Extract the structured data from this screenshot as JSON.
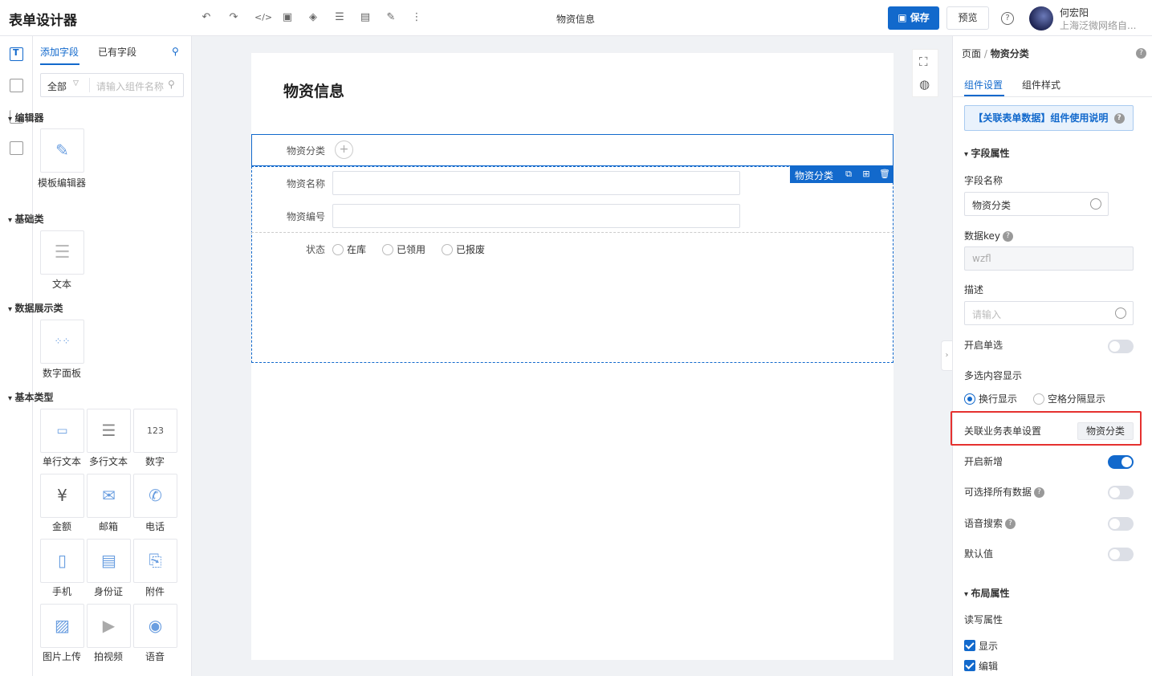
{
  "header": {
    "app_title": "表单设计器",
    "form_name": "物资信息",
    "save_label": "保存",
    "preview_label": "预览",
    "help_label": "?",
    "user_name": "何宏阳",
    "user_company": "上海泛微网络自..."
  },
  "left_panel": {
    "tabs": [
      "添加字段",
      "已有字段"
    ],
    "active_tab": "添加字段",
    "filter_value": "全部",
    "search_placeholder": "请输入组件名称",
    "categories": [
      {
        "name": "编辑器",
        "widgets": [
          "模板编辑器"
        ]
      },
      {
        "name": "基础类",
        "widgets": [
          "文本"
        ]
      },
      {
        "name": "数据展示类",
        "widgets": [
          "数字面板"
        ]
      },
      {
        "name": "基本类型",
        "widgets": [
          "单行文本",
          "多行文本",
          "数字",
          "金额",
          "邮箱",
          "电话",
          "手机",
          "身份证",
          "附件",
          "图片上传",
          "拍视频",
          "语音"
        ]
      }
    ],
    "number_icon_text": "123",
    "currency_icon_text": "¥"
  },
  "canvas": {
    "form_title": "物资信息",
    "selected_field_label": "物资分类",
    "group_tag_label": "物资分类",
    "fields": [
      {
        "label": "物资名称",
        "value": ""
      },
      {
        "label": "物资编号",
        "value": ""
      }
    ],
    "status_label": "状态",
    "status_options": [
      "在库",
      "已领用",
      "已报废"
    ]
  },
  "right_panel": {
    "breadcrumb_root": "页面",
    "breadcrumb_sep": "/",
    "breadcrumb_current": "物资分类",
    "tabs": [
      "组件设置",
      "组件样式"
    ],
    "active_tab": "组件设置",
    "notice": "【关联表单数据】组件使用说明",
    "section_field": "字段属性",
    "field_name_label": "字段名称",
    "field_name_value": "物资分类",
    "data_key_label": "数据key",
    "data_key_value": "wzfl",
    "desc_label": "描述",
    "desc_placeholder": "请输入",
    "single_select_label": "开启单选",
    "single_select_on": false,
    "multi_display_label": "多选内容显示",
    "multi_display_options": [
      "换行显示",
      "空格分隔显示"
    ],
    "multi_display_selected": "换行显示",
    "related_form_label": "关联业务表单设置",
    "related_form_value": "物资分类",
    "enable_add_label": "开启新增",
    "enable_add_on": true,
    "select_all_label": "可选择所有数据",
    "select_all_on": false,
    "voice_search_label": "语音搜索",
    "voice_search_on": false,
    "default_value_label": "默认值",
    "default_value_on": false,
    "section_layout": "布局属性",
    "rw_label": "读写属性",
    "rw_options": [
      "显示",
      "编辑"
    ]
  },
  "colors": {
    "accent": "#1269cc",
    "highlight_box": "#e5312f"
  }
}
